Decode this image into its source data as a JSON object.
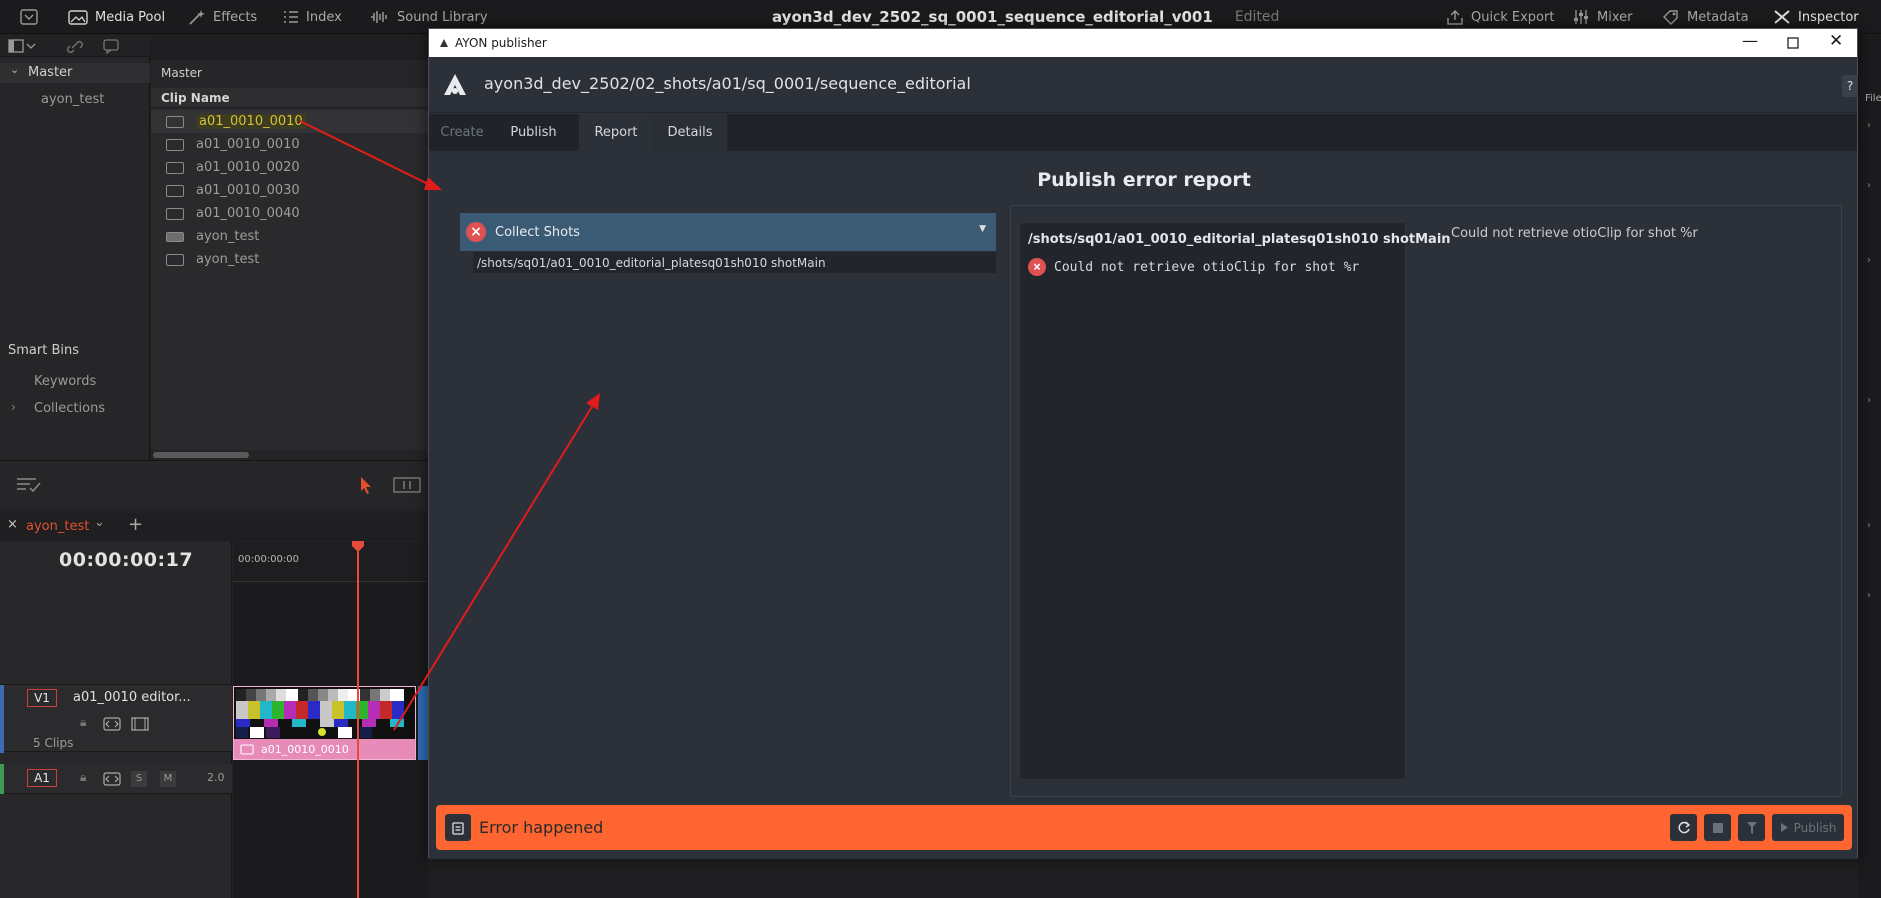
{
  "topbar": {
    "media_pool": "Media Pool",
    "effects": "Effects",
    "index": "Index",
    "sound_library": "Sound Library",
    "project_title": "ayon3d_dev_2502_sq_0001_sequence_editorial_v001",
    "edited": "Edited",
    "quick_export": "Quick Export",
    "mixer": "Mixer",
    "metadata": "Metadata",
    "inspector": "Inspector"
  },
  "bins": {
    "master": "Master",
    "item": "ayon_test",
    "smart_bins": "Smart Bins",
    "keywords": "Keywords",
    "collections": "Collections"
  },
  "pool": {
    "header": "Master",
    "column": "Clip Name",
    "clips": [
      "a01_0010_0010",
      "a01_0010_0010",
      "a01_0010_0020",
      "a01_0010_0030",
      "a01_0010_0040",
      "ayon_test",
      "ayon_test"
    ]
  },
  "timeline": {
    "tab_name": "ayon_test",
    "timecode": "00:00:00:17",
    "ruler_start": "00:00:00:00",
    "v1": "V1",
    "track_name": "a01_0010 editor...",
    "clip_count": "5 Clips",
    "a1": "A1",
    "audio_level": "2.0",
    "clip_label": "a01_0010_0010",
    "solo": "S",
    "mute": "M"
  },
  "right_strip": {
    "label": "File"
  },
  "ayon": {
    "window_title": "AYON publisher",
    "context_path": "ayon3d_dev_2502/02_shots/a01/sq_0001/sequence_editorial",
    "help": "?",
    "tabs": [
      "Create",
      "Publish",
      "Report",
      "Details"
    ],
    "report_title": "Publish error report",
    "plugin": "Collect Shots",
    "instance": "/shots/sq01/a01_0010_editorial_platesq01sh010 shotMain",
    "details_header": "/shots/sq01/a01_0010_editorial_platesq01sh010 shotMain",
    "error_message": "Could not retrieve otioClip for shot %r",
    "details_text": "Could not retrieve otioClip for shot %r",
    "footer_message": "Error happened",
    "publish_button": "Publish"
  },
  "colors": {
    "footer_error": "#ff6530",
    "accent_group": "#3b5a73",
    "error_icon": "#e05252",
    "annotation_arrow": "#e21b1b",
    "clip_pink": "#e78bb8",
    "playhead": "#e84a3c"
  }
}
